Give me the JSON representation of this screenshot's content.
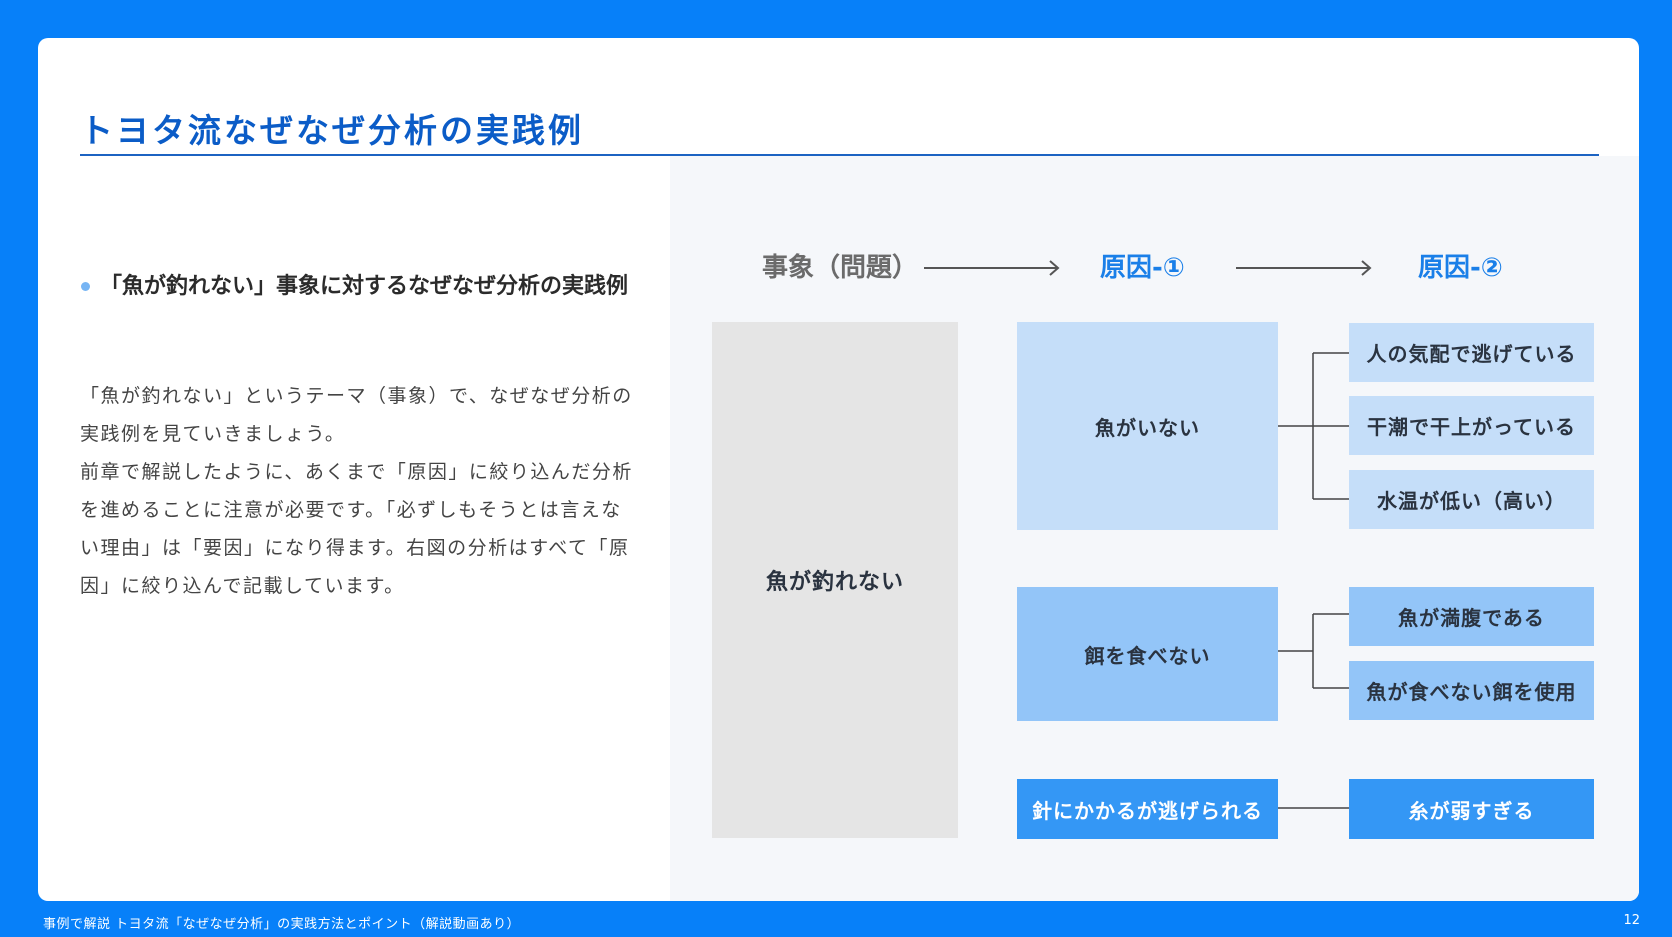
{
  "slide": {
    "title": "トヨタ流なぜなぜ分析の実践例",
    "bullet": "「魚が釣れない」事象に対するなぜなぜ分析の実践例",
    "paragraphs": [
      "「魚が釣れない」というテーマ（事象）で、なぜなぜ分析の実践例を見ていきましょう。",
      "前章で解説したように、あくまで「原因」に絞り込んだ分析を進めることに注意が必要です。「必ずしもそうとは言えない理由」は「要因」になり得ます。右図の分析はすべて「原因」に絞り込んで記載しています。"
    ]
  },
  "diagram": {
    "headers": {
      "event": "事象（問題）",
      "cause1": "原因-①",
      "cause2": "原因-②"
    },
    "event": "魚が釣れない",
    "cause1": [
      "魚がいない",
      "餌を食べない",
      "針にかかるが逃げられる"
    ],
    "cause2": {
      "group1": [
        "人の気配で逃げている",
        "干潮で干上がっている",
        "水温が低い（高い）"
      ],
      "group2": [
        "魚が満腹である",
        "魚が食べない餌を使用"
      ],
      "group3": [
        "糸が弱すぎる"
      ]
    }
  },
  "footer": {
    "source": "事例で解説 トヨタ流「なぜなぜ分析」の実践方法とポイント（解説動画あり）",
    "page": "12"
  },
  "colors": {
    "frame": "#0780f9",
    "title": "#0b5cc7",
    "event_box": "#e5e5e5",
    "tier1": "#c5def9",
    "tier2": "#93c5f8",
    "tier3": "#3497f5"
  }
}
